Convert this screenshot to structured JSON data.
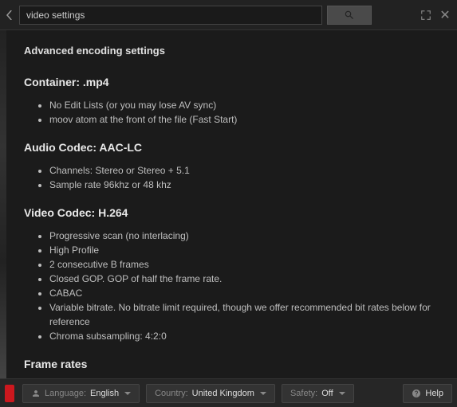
{
  "search": {
    "value": "video settings"
  },
  "title": "Advanced encoding settings",
  "sections": {
    "container": {
      "heading": "Container: .mp4",
      "items": [
        "No Edit Lists (or you may lose AV sync)",
        "moov atom at the front of the file (Fast Start)"
      ]
    },
    "audio": {
      "heading": "Audio Codec: AAC-LC",
      "items": [
        "Channels: Stereo or Stereo + 5.1",
        "Sample rate 96khz or 48 khz"
      ]
    },
    "video": {
      "heading": "Video Codec: H.264",
      "items": [
        "Progressive scan (no interlacing)",
        "High Profile",
        "2 consecutive B frames",
        "Closed GOP. GOP of half the frame rate.",
        "CABAC",
        "Variable bitrate. No bitrate limit required, though we offer recommended bit rates below for reference",
        "Chroma subsampling: 4:2:0"
      ]
    },
    "framerates": {
      "heading": "Frame rates"
    }
  },
  "footer": {
    "language": {
      "label": "Language:",
      "value": "English"
    },
    "country": {
      "label": "Country:",
      "value": "United Kingdom"
    },
    "safety": {
      "label": "Safety:",
      "value": "Off"
    },
    "help": {
      "label": "Help"
    }
  }
}
